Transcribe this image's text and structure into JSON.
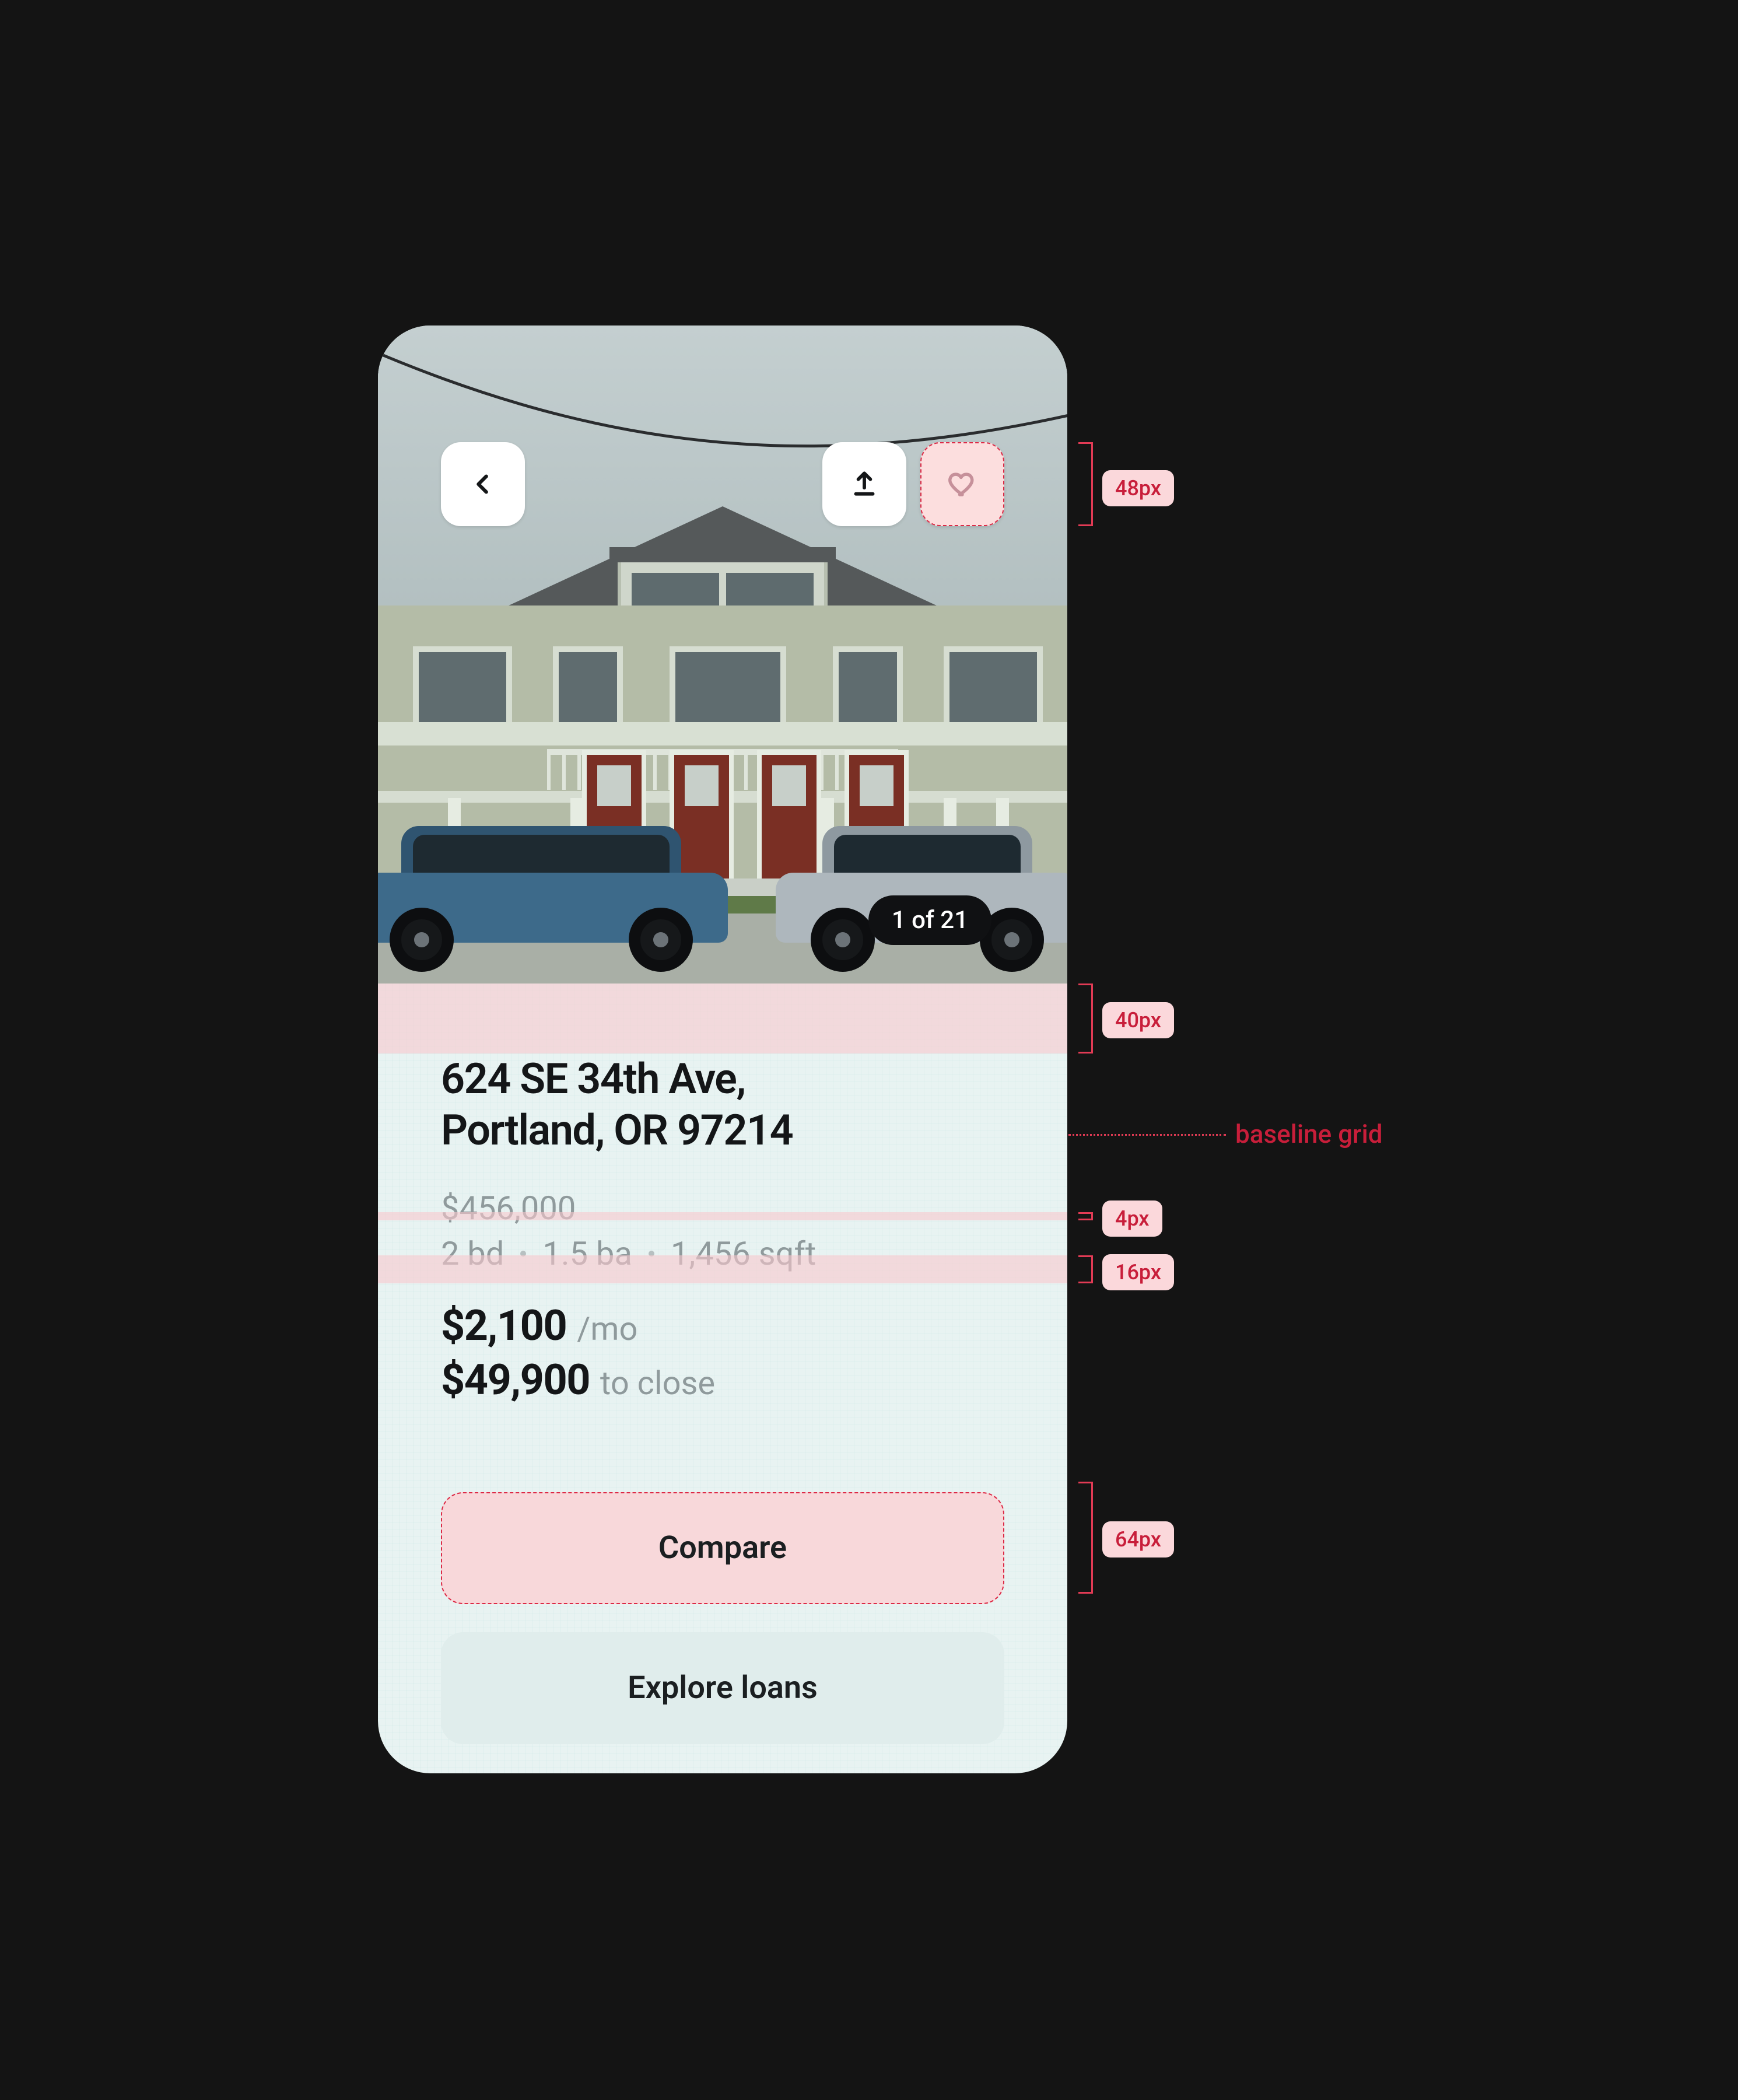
{
  "hero": {
    "photo_counter": "1 of 21"
  },
  "actions": {
    "back_icon": "chevron-left",
    "share_icon": "upload",
    "favorite_icon": "heart"
  },
  "listing": {
    "address_line1": "624 SE 34th Ave,",
    "address_line2": "Portland, OR 97214",
    "list_price": "$456,000",
    "beds": "2 bd",
    "baths": "1.5 ba",
    "sqft": "1,456 sqft",
    "monthly_amount": "$2,100",
    "monthly_suffix": "/mo",
    "close_amount": "$49,900",
    "close_suffix": "to close"
  },
  "buttons": {
    "compare": "Compare",
    "explore": "Explore loans"
  },
  "annotations": {
    "btn48": "48px",
    "gap40": "40px",
    "baseline": "baseline grid",
    "gap4": "4px",
    "gap16": "16px",
    "btn64": "64px"
  }
}
